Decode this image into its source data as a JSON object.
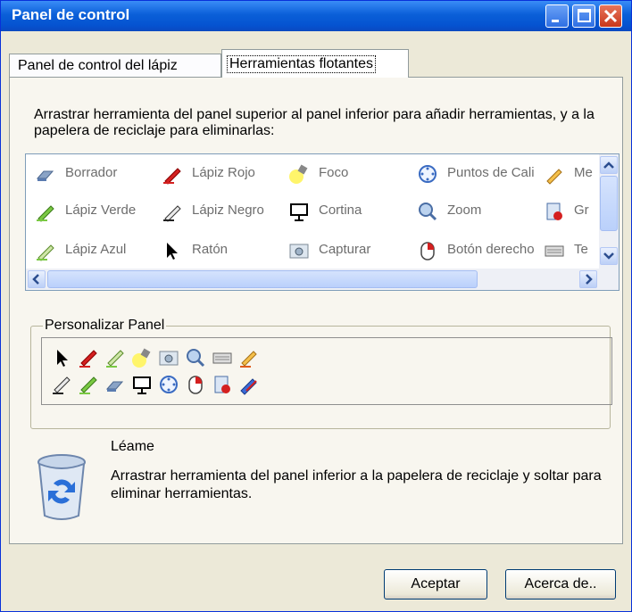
{
  "window": {
    "title": "Panel de control"
  },
  "tabs": [
    "Panel de control del lápiz",
    "Herramientas flotantes"
  ],
  "instructions": "Arrastrar herramienta del panel superior al panel inferior para añadir herramientas, y a la papelera de reciclaje para eliminarlas:",
  "tools": {
    "row1": [
      "Borrador",
      "Lápiz Rojo",
      "Foco",
      "Puntos de Cali",
      "Me"
    ],
    "row2": [
      "Lápiz Verde",
      "Lápiz Negro",
      "Cortina",
      "Zoom",
      "Gr"
    ],
    "row3": [
      "Lápiz Azul",
      "Ratón",
      "Capturar",
      "Botón derecho",
      "Te"
    ]
  },
  "customize": {
    "title": "Personalizar Panel",
    "row1_icons": [
      "cursor-arrow-icon",
      "red-pen-icon",
      "green-pen-icon",
      "spotlight-icon",
      "capture-icon",
      "zoom-icon",
      "keyboard-icon",
      "highlighter-icon"
    ],
    "row2_icons": [
      "black-pen-icon",
      "green-pen-icon",
      "eraser-icon",
      "curtain-icon",
      "target-icon",
      "mouse-icon",
      "record-icon",
      "blue-pen-icon"
    ]
  },
  "readme": {
    "title": "Léame",
    "text": "Arrastrar herramienta del panel inferior a la papelera de reciclaje y soltar para eliminar herramientas."
  },
  "buttons": {
    "ok": "Aceptar",
    "about": "Acerca de.."
  },
  "colors": {
    "titlebar": "#0a5fd8",
    "window_bg": "#ece9d8",
    "close": "#c8371b"
  }
}
